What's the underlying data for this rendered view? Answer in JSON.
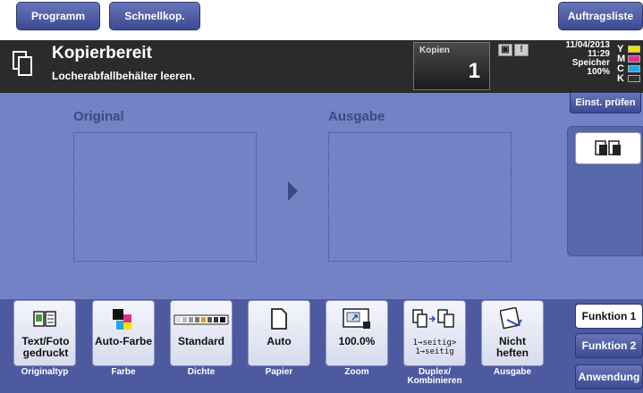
{
  "topbar": {
    "tabs": [
      {
        "label": "Programm"
      },
      {
        "label": "Schnellkop."
      },
      {
        "label": "Auftragsliste"
      }
    ]
  },
  "status": {
    "title": "Kopierbereit",
    "message": "Locherabfallbehälter leeren.",
    "copies_label": "Kopien",
    "copies_value": "1",
    "date": "11/04/2013",
    "time": "11:29",
    "memory_label": "Speicher",
    "memory_value": "100%",
    "toner": [
      {
        "key": "Y",
        "color": "#f2e200"
      },
      {
        "key": "M",
        "color": "#e0308f"
      },
      {
        "key": "C",
        "color": "#20a8e0"
      },
      {
        "key": "K",
        "color": "#303030"
      }
    ]
  },
  "main": {
    "original_label": "Original",
    "output_label": "Ausgabe",
    "check_settings": "Einst. prüfen"
  },
  "functions": [
    {
      "value": "Text/Foto gedruckt",
      "caption": "Originaltyp",
      "icon": "original-type-icon"
    },
    {
      "value": "Auto-Farbe",
      "caption": "Farbe",
      "icon": "color-icon"
    },
    {
      "value": "Standard",
      "caption": "Dichte",
      "icon": "density-icon"
    },
    {
      "value": "Auto",
      "caption": "Papier",
      "icon": "paper-icon"
    },
    {
      "value": "100.0%",
      "caption": "Zoom",
      "icon": "zoom-icon"
    },
    {
      "value": "1→seitig> 1→seitig",
      "caption": "Duplex/ Kombinieren",
      "icon": "duplex-icon"
    },
    {
      "value": "Nicht heften",
      "caption": "Ausgabe",
      "icon": "staple-icon"
    }
  ],
  "side_tabs": [
    {
      "label": "Funktion 1"
    },
    {
      "label": "Funktion 2"
    },
    {
      "label": "Anwendung"
    }
  ]
}
